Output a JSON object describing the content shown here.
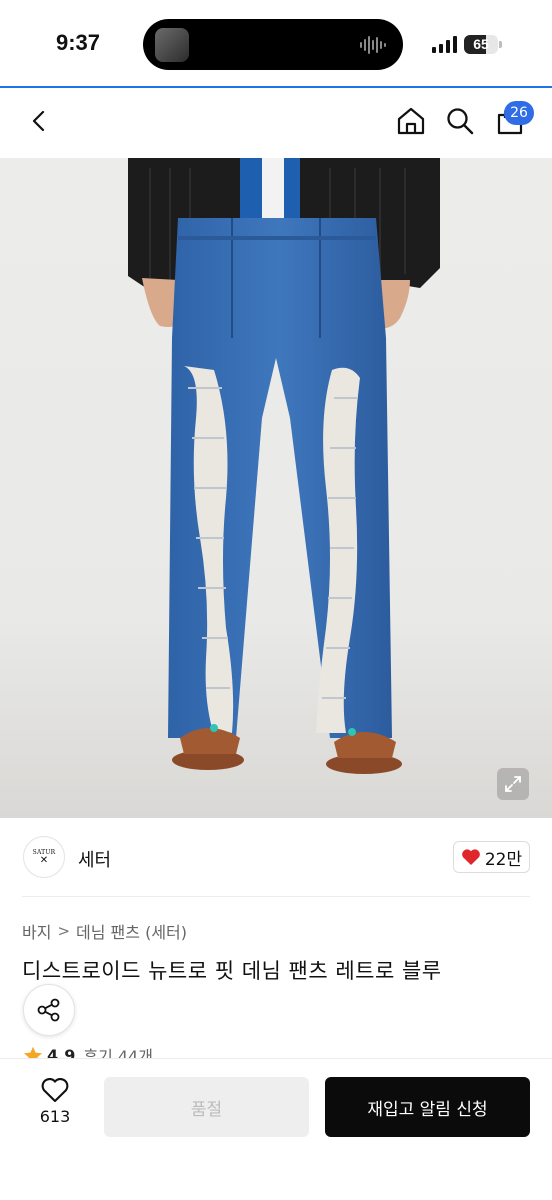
{
  "status_bar": {
    "time": "9:37",
    "battery": "65",
    "battery_level": 0.65
  },
  "header": {
    "back_icon": "chevron-left-icon",
    "home_icon": "home-icon",
    "search_icon": "search-icon",
    "cart_icon": "shopping-bag-icon",
    "cart_badge": "26",
    "badge_color": "#2f6ce6"
  },
  "product_image": {
    "expand_icon": "expand-icon"
  },
  "brand": {
    "logo_text": "SATUR",
    "name": "세터",
    "like_count": "22만",
    "heart_color": "#e0252b"
  },
  "breadcrumb": {
    "items": [
      "바지",
      "데님 팬츠 (세터)"
    ],
    "separator": ">"
  },
  "product": {
    "title": "디스트로이드 뉴트로 핏 데님 팬츠 레트로 블루",
    "rating": "4.9",
    "review_text": "후기 44개",
    "star_color": "#f5a623"
  },
  "bottom_bar": {
    "wish_count": "613",
    "soldout_label": "품절",
    "restock_label": "재입고 알림 신청"
  }
}
